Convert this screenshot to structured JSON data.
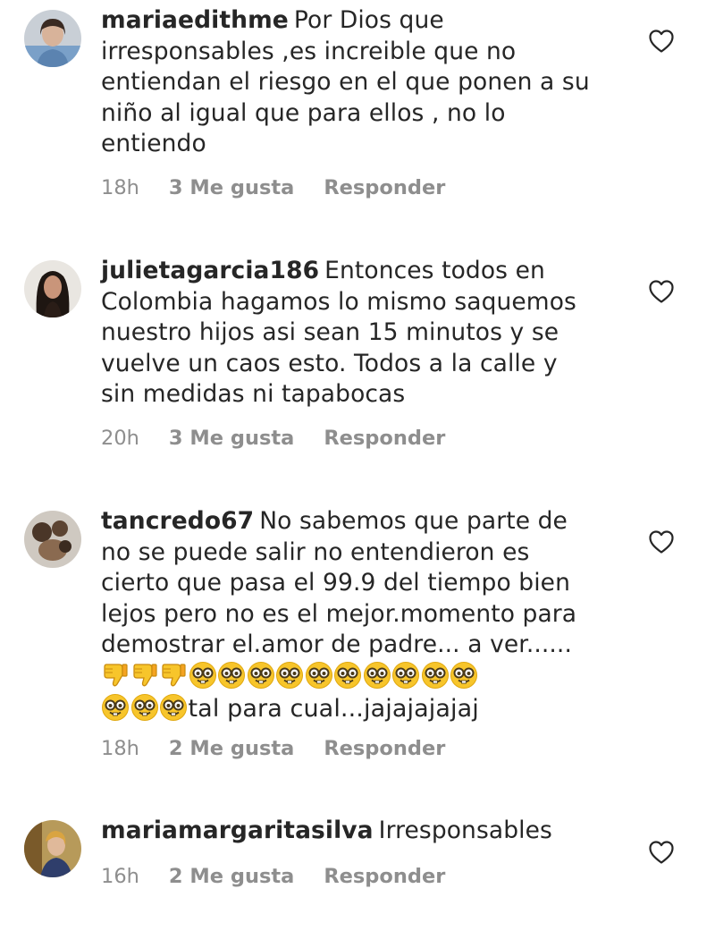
{
  "comments": [
    {
      "username": "mariaedithme",
      "text": "Por Dios que irresponsables ,es increible que no entiendan el riesgo en el que ponen a su niño al igual que para ellos , no lo entiendo",
      "lines": [
        "Por Dios que",
        "irresponsables ,es increible que no",
        "entiendan el riesgo en el que ponen a su",
        "niño al igual que para ellos , no lo",
        "entiendo"
      ],
      "time": "18h",
      "likes": "3 Me gusta",
      "reply_label": "Responder",
      "avatar_icon": "avatar-photo"
    },
    {
      "username": "julietagarcia186",
      "text": "Entonces todos en Colombia hagamos lo mismo saquemos nuestro hijos asi sean 15 minutos y se vuelve un caos esto. Todos a la calle y sin medidas ni tapabocas",
      "lines": [
        "Entonces todos en",
        "Colombia hagamos lo mismo saquemos",
        "nuestro hijos asi sean 15 minutos y se",
        "vuelve un caos esto. Todos a la calle y",
        "sin medidas ni tapabocas"
      ],
      "time": "20h",
      "likes": "3 Me gusta",
      "reply_label": "Responder",
      "avatar_icon": "avatar-photo"
    },
    {
      "username": "tancredo67",
      "text": "No sabemos que parte de no se puede salir no entendieron es cierto que pasa el 99.9 del tiempo bien lejos pero no es el mejor.momento para demostrar el.amor de padre... a ver...... tal para cual...jajajajajaj",
      "lines": [
        "No sabemos que parte de",
        "no se puede salir no entendieron es",
        "cierto que pasa el 99.9 del tiempo bien",
        "lejos pero no es el mejor.momento para",
        "demostrar el.amor de padre... a ver......"
      ],
      "emoji_line_1": [
        "thumbs-down",
        "thumbs-down",
        "thumbs-down",
        "nerd-face",
        "nerd-face",
        "nerd-face",
        "nerd-face",
        "nerd-face",
        "nerd-face",
        "nerd-face",
        "nerd-face",
        "nerd-face",
        "nerd-face"
      ],
      "emoji_line_2": [
        "nerd-face",
        "nerd-face",
        "nerd-face"
      ],
      "tail_text": "tal para cual...jajajajajaj",
      "time": "18h",
      "likes": "2 Me gusta",
      "reply_label": "Responder",
      "avatar_icon": "avatar-photo"
    },
    {
      "username": "mariamargaritasilva",
      "text": "Irresponsables",
      "lines": [
        "Irresponsables"
      ],
      "time": "16h",
      "likes": "2 Me gusta",
      "reply_label": "Responder",
      "avatar_icon": "avatar-photo"
    }
  ],
  "icons": {
    "like": "heart-outline-icon",
    "thumbs_down": "thumbs-down-emoji",
    "nerd": "nerd-face-emoji"
  },
  "colors": {
    "text": "#262626",
    "meta": "#8e8e8e",
    "emoji_yellow": "#f7c52b"
  }
}
